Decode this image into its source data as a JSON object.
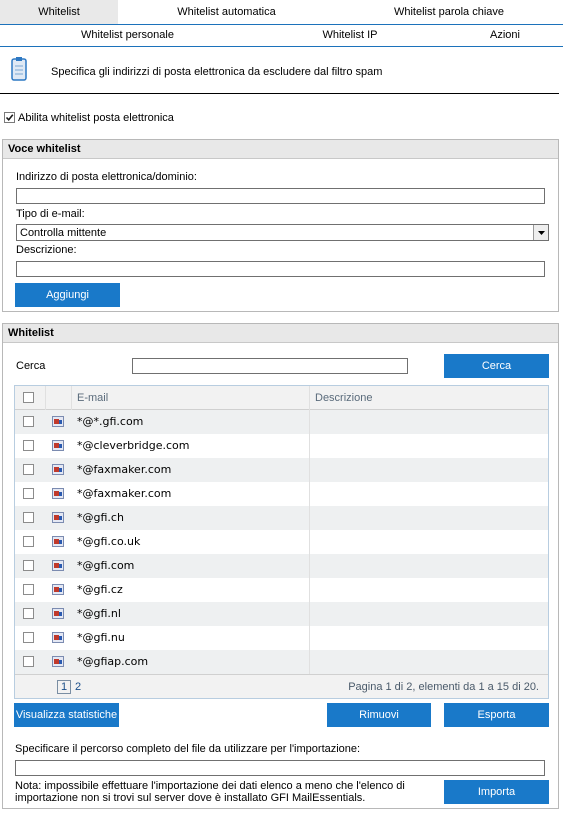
{
  "tabs": [
    "Whitelist",
    "Whitelist automatica",
    "Whitelist parola chiave"
  ],
  "subtabs": [
    "Whitelist personale",
    "Whitelist IP",
    "Azioni"
  ],
  "description": "Specifica gli indirizzi di posta elettronica da escludere dal filtro spam",
  "enable_label": "Abilita whitelist posta elettronica",
  "entry": {
    "title": "Voce whitelist",
    "address_label": "Indirizzo di posta elettronica/dominio:",
    "type_label": "Tipo di e-mail:",
    "type_value": "Controlla mittente",
    "desc_label": "Descrizione:",
    "add_button": "Aggiungi"
  },
  "list": {
    "title": "Whitelist",
    "search_label": "Cerca",
    "search_button": "Cerca",
    "col_email": "E-mail",
    "col_desc": "Descrizione",
    "rows": [
      "*@*.gfi.com",
      "*@cleverbridge.com",
      "*@faxmaker.com",
      "*@faxmaker.com",
      "*@gfi.ch",
      "*@gfi.co.uk",
      "*@gfi.com",
      "*@gfi.cz",
      "*@gfi.nl",
      "*@gfi.nu",
      "*@gfiap.com"
    ],
    "page1": "1",
    "page2": "2",
    "pager_text": "Pagina 1 di 2, elementi da 1 a 15 di 20.",
    "stats_button": "Visualizza statistiche",
    "remove_button": "Rimuovi",
    "export_button": "Esporta",
    "import_label": "Specificare il percorso completo del file da utilizzare per l'importazione:",
    "import_note": "Nota: impossibile effettuare l'importazione dei dati elenco a meno che l'elenco di importazione non si trovi sul server dove è installato GFI MailEssentials.",
    "import_button": "Importa"
  }
}
